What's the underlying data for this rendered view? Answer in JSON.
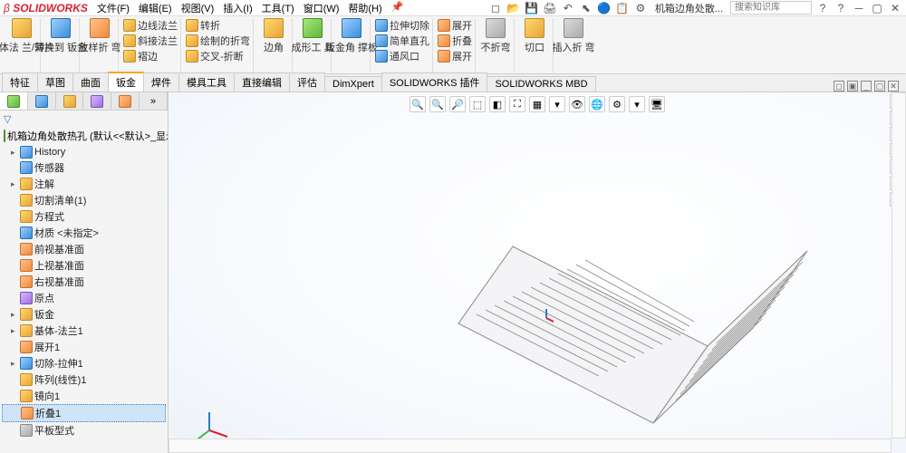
{
  "app": {
    "name": "SOLIDWORKS",
    "doc": "机箱边角处散..."
  },
  "menubar": [
    "文件(F)",
    "编辑(E)",
    "视图(V)",
    "插入(I)",
    "工具(T)",
    "窗口(W)",
    "帮助(H)"
  ],
  "search": {
    "placeholder": "搜索知识库"
  },
  "ribbon": {
    "large": [
      {
        "label": "基体法\n兰/薄片"
      },
      {
        "label": "转换到\n钣金"
      },
      {
        "label": "放样折\n弯"
      }
    ],
    "col1": [
      "边线法兰",
      "斜接法兰",
      "褶边"
    ],
    "col2": [
      "转折",
      "绘制的折弯",
      "交叉-折断"
    ],
    "large2": [
      {
        "label": "边角"
      },
      {
        "label": "成形工\n具"
      },
      {
        "label": "钣金角\n撑板"
      }
    ],
    "col3": [
      "拉伸切除",
      "简单直孔",
      "通风口"
    ],
    "col4": [
      "展开",
      "折叠",
      "展开"
    ],
    "large3": [
      {
        "label": "不折弯"
      },
      {
        "label": "切口"
      },
      {
        "label": "插入折\n弯"
      }
    ]
  },
  "tabs": [
    "特征",
    "草图",
    "曲面",
    "钣金",
    "焊件",
    "模具工具",
    "直接编辑",
    "评估",
    "DimXpert",
    "SOLIDWORKS 插件",
    "SOLIDWORKS MBD"
  ],
  "activeTab": 3,
  "sidebar": {
    "doc": "机箱边角处散热孔  (默认<<默认>_显示状",
    "tree": [
      {
        "e": "▸",
        "t": "History"
      },
      {
        "e": "",
        "t": "传感器"
      },
      {
        "e": "▸",
        "t": "注解"
      },
      {
        "e": "",
        "t": "切割清单(1)"
      },
      {
        "e": "",
        "t": "方程式"
      },
      {
        "e": "",
        "t": "材质 <未指定>"
      },
      {
        "e": "",
        "t": "前视基准面"
      },
      {
        "e": "",
        "t": "上视基准面"
      },
      {
        "e": "",
        "t": "右视基准面"
      },
      {
        "e": "",
        "t": "原点"
      },
      {
        "e": "▸",
        "t": "钣金"
      },
      {
        "e": "▸",
        "t": "基体-法兰1"
      },
      {
        "e": "",
        "t": "展开1"
      },
      {
        "e": "▸",
        "t": "切除-拉伸1"
      },
      {
        "e": "",
        "t": "阵列(线性)1"
      },
      {
        "e": "",
        "t": "镜向1"
      },
      {
        "e": "",
        "t": "折叠1",
        "sel": true
      },
      {
        "e": "",
        "t": "平板型式"
      }
    ]
  },
  "viewtoolIcons": [
    "🔍",
    "🔍",
    "🔎",
    "⬚",
    "◧",
    "⛶",
    "▦",
    "▾",
    "👁",
    "🌐",
    "⚙",
    "▾",
    "🖥"
  ]
}
